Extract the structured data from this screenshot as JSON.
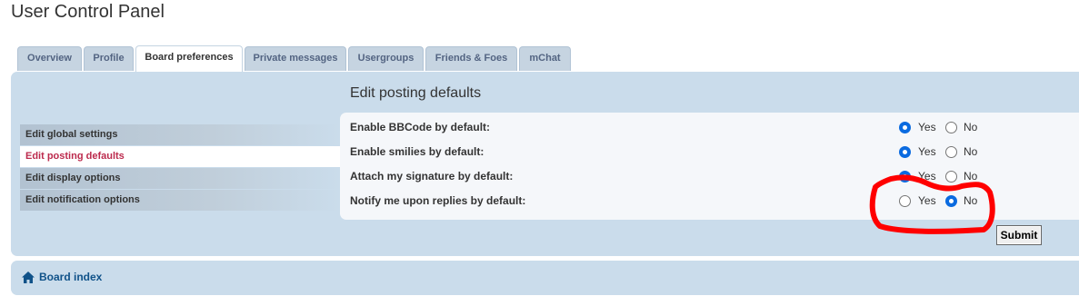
{
  "header": {
    "title": "User Control Panel"
  },
  "tabs": [
    {
      "label": "Overview",
      "active": false
    },
    {
      "label": "Profile",
      "active": false
    },
    {
      "label": "Board preferences",
      "active": true
    },
    {
      "label": "Private messages",
      "active": false
    },
    {
      "label": "Usergroups",
      "active": false
    },
    {
      "label": "Friends & Foes",
      "active": false
    },
    {
      "label": "mChat",
      "active": false
    }
  ],
  "sidebar": {
    "items": [
      {
        "label": "Edit global settings",
        "active": false
      },
      {
        "label": "Edit posting defaults",
        "active": true
      },
      {
        "label": "Edit display options",
        "active": false
      },
      {
        "label": "Edit notification options",
        "active": false
      }
    ]
  },
  "main": {
    "title": "Edit posting defaults",
    "yes_label": "Yes",
    "no_label": "No",
    "rows": [
      {
        "label": "Enable BBCode by default:",
        "value": "Yes"
      },
      {
        "label": "Enable smilies by default:",
        "value": "Yes"
      },
      {
        "label": "Attach my signature by default:",
        "value": "Yes"
      },
      {
        "label": "Notify me upon replies by default:",
        "value": "No"
      }
    ],
    "submit_label": "Submit"
  },
  "footer": {
    "board_index_label": "Board index"
  },
  "colors": {
    "panel_bg": "#cadceb",
    "active_menu_text": "#bc2a4d",
    "link": "#105289",
    "radio_checked": "#0b6be0",
    "annotation_red": "#ff0000"
  }
}
